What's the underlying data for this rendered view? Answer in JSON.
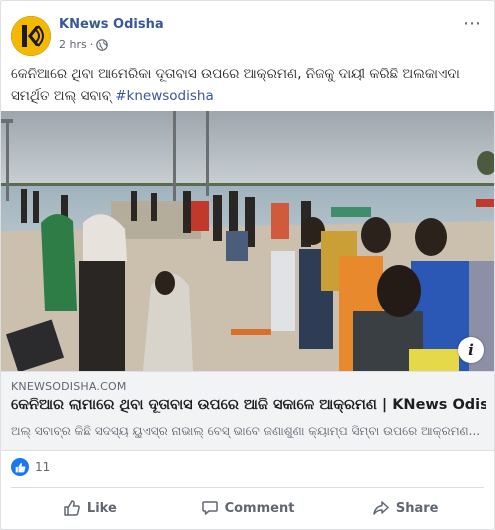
{
  "post": {
    "page_name": "KNews Odisha",
    "time": "2 hrs",
    "separator": "·",
    "more_icon": "⋯",
    "text": "କେନିଆରେ ଥିବା ଆମେରିକା ଦୂତାବାସ ଉପରେ ଆକ୍ରମଣ, ନିଜକୁ ଦାୟୀ କରିଛି ଅଲକାଏଦା ସମର୍ଥିତ ଅଲ୍ ସବାବ୍",
    "hashtag": "#knewsodisha"
  },
  "link": {
    "domain": "KNEWSODISHA.COM",
    "title": "କେନିଆର ଲାମାରେ ଥିବା ଦୂତାବାସ ଉପରେ ଆଜି ସକାଳେ ଆକ୍ରମଣ | KNews Odisha",
    "description": "ଅଲ୍ ସବାବ୍‌ର କିଛି ସଦସ୍ୟ ୟୁଏସ୍‌ର ନାଭାଲ୍ ବେସ୍ ଭାବେ ଜଣାଶୁଣା କ୍ୟାମ୍ପ ସିମ୍ବା ଉପରେ ଆକ୍ରମଣ...",
    "info_label": "i"
  },
  "reactions": {
    "count": "11"
  },
  "actions": {
    "like": "Like",
    "comment": "Comment",
    "share": "Share"
  },
  "colors": {
    "brand": "#385898",
    "like_blue": "#1877f2",
    "logo_gold": "#f5b800"
  }
}
